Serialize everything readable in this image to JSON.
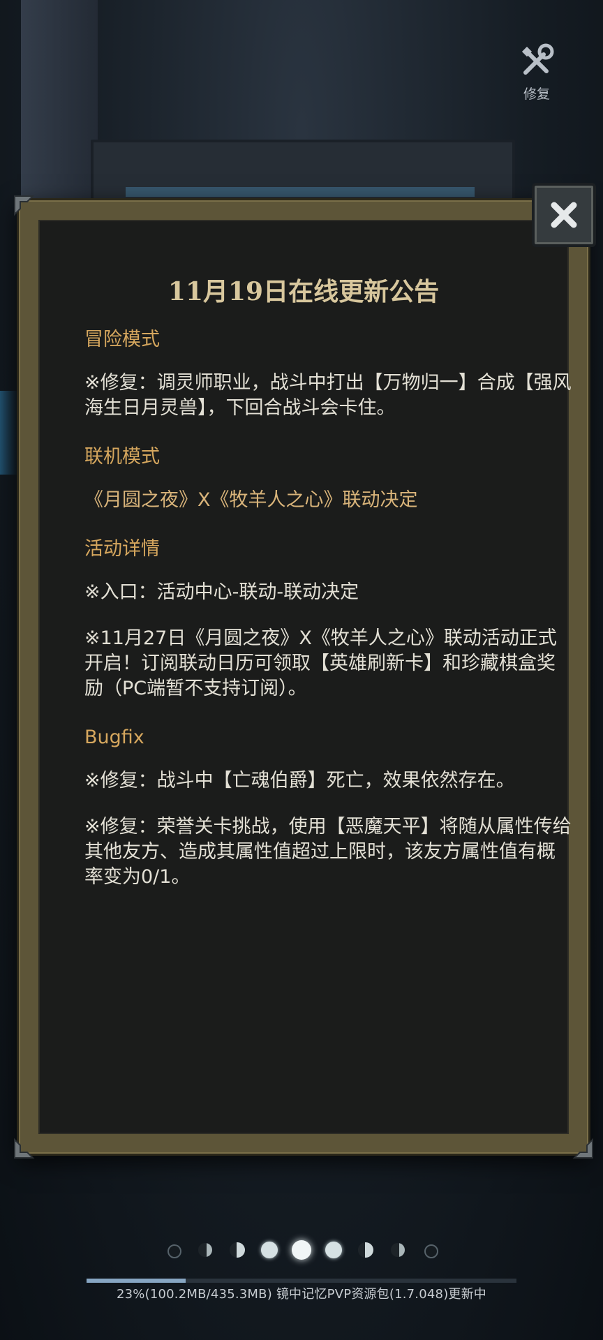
{
  "toolbar": {
    "repair_label": "修复"
  },
  "notice": {
    "title": "11月19日在线更新公告",
    "sections": [
      {
        "heading": "冒险模式",
        "paragraphs": [
          "※修复：调灵师职业，战斗中打出【万物归一】合成【强风海生日月灵兽】，下回合战斗会卡住。"
        ]
      },
      {
        "heading": "联机模式",
        "paragraphs": [
          "《月圆之夜》X《牧羊人之心》联动决定"
        ]
      },
      {
        "heading": "活动详情",
        "paragraphs": [
          "※入口：活动中心-联动-联动决定",
          "※11月27日《月圆之夜》X《牧羊人之心》联动活动正式开启！订阅联动日历可领取【英雄刷新卡】和珍藏棋盒奖励（PC端暂不支持订阅）。"
        ]
      },
      {
        "heading": "Bugfix",
        "paragraphs": [
          "※修复：战斗中【亡魂伯爵】死亡，效果依然存在。",
          "※修复：荣誉关卡挑战，使用【恶魔天平】将随从属性传给其他友方、造成其属性值超过上限时，该友方属性值有概率变为0/1。"
        ]
      }
    ]
  },
  "pager": {
    "total": 9,
    "current": 4
  },
  "download": {
    "progress": 0.23,
    "status_text": "23%(100.2MB/435.3MB) 镜中记忆PVP资源包(1.7.048)更新中"
  },
  "colors": {
    "heading": "#d6a75e",
    "title": "#d8c79d",
    "body_text": "#e3e0d5",
    "panel_bg": "#1b1c1b"
  }
}
